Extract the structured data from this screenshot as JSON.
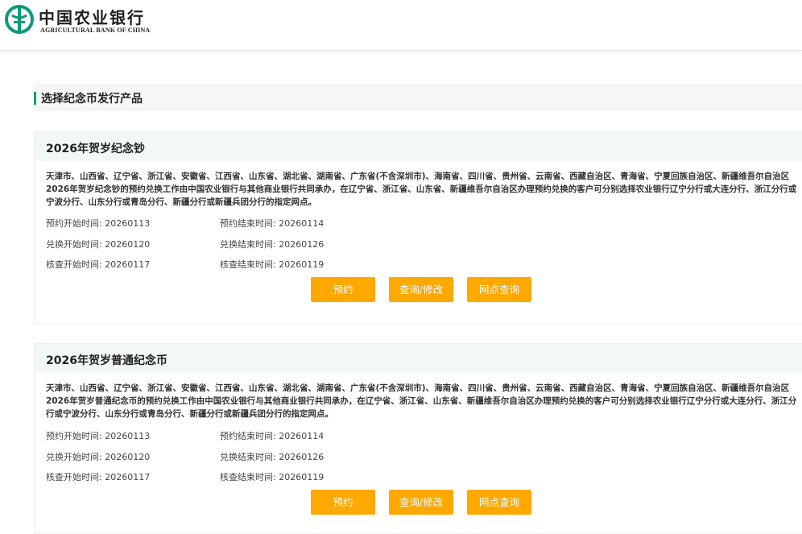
{
  "header": {
    "logo_cn": "中国农业银行",
    "logo_en": "AGRICULTURAL BANK OF CHINA"
  },
  "section": {
    "title": "选择纪念币发行产品"
  },
  "products": [
    {
      "title": "2026年贺岁纪念钞",
      "desc": "天津市、山西省、辽宁省、浙江省、安徽省、江西省、山东省、湖北省、湖南省、广东省(不含深圳市)、海南省、四川省、贵州省、云南省、西藏自治区、青海省、宁夏回族自治区、新疆维吾尔自治区2026年贺岁纪念钞的预约兑换工作由中国农业银行与其他商业银行共同承办，在辽宁省、浙江省、山东省、新疆维吾尔自治区办理预约兑换的客户可分别选择农业银行辽宁分行或大连分行、浙江分行或宁波分行、山东分行或青岛分行、新疆分行或新疆兵团分行的指定网点。",
      "reserve_start": "预约开始时间: 20260113",
      "reserve_end": "预约结束时间: 20260114",
      "exchange_start": "兑换开始时间: 20260120",
      "exchange_end": "兑换结束时间: 20260126",
      "check_start": "核查开始时间: 20260117",
      "check_end": "核查结束时间: 20260119",
      "btn_reserve": "预约",
      "btn_query": "查询/修改",
      "btn_branch": "网点查询"
    },
    {
      "title": "2026年贺岁普通纪念币",
      "desc": "天津市、山西省、辽宁省、浙江省、安徽省、江西省、山东省、湖北省、湖南省、广东省(不含深圳市)、海南省、四川省、贵州省、云南省、西藏自治区、青海省、宁夏回族自治区、新疆维吾尔自治区2026年贺岁普通纪念币的预约兑换工作由中国农业银行与其他商业银行共同承办，在辽宁省、浙江省、山东省、新疆维吾尔自治区办理预约兑换的客户可分别选择农业银行辽宁分行或大连分行、浙江分行或宁波分行、山东分行或青岛分行、新疆分行或新疆兵团分行的指定网点。",
      "reserve_start": "预约开始时间: 20260113",
      "reserve_end": "预约结束时间: 20260114",
      "exchange_start": "兑换开始时间: 20260120",
      "exchange_end": "兑换结束时间: 20260126",
      "check_start": "核查开始时间: 20260117",
      "check_end": "核查结束时间: 20260119",
      "btn_reserve": "预约",
      "btn_query": "查询/修改",
      "btn_branch": "网点查询"
    }
  ],
  "colors": {
    "brand_green": "#0a9a7a",
    "button_orange": "#fea800"
  }
}
